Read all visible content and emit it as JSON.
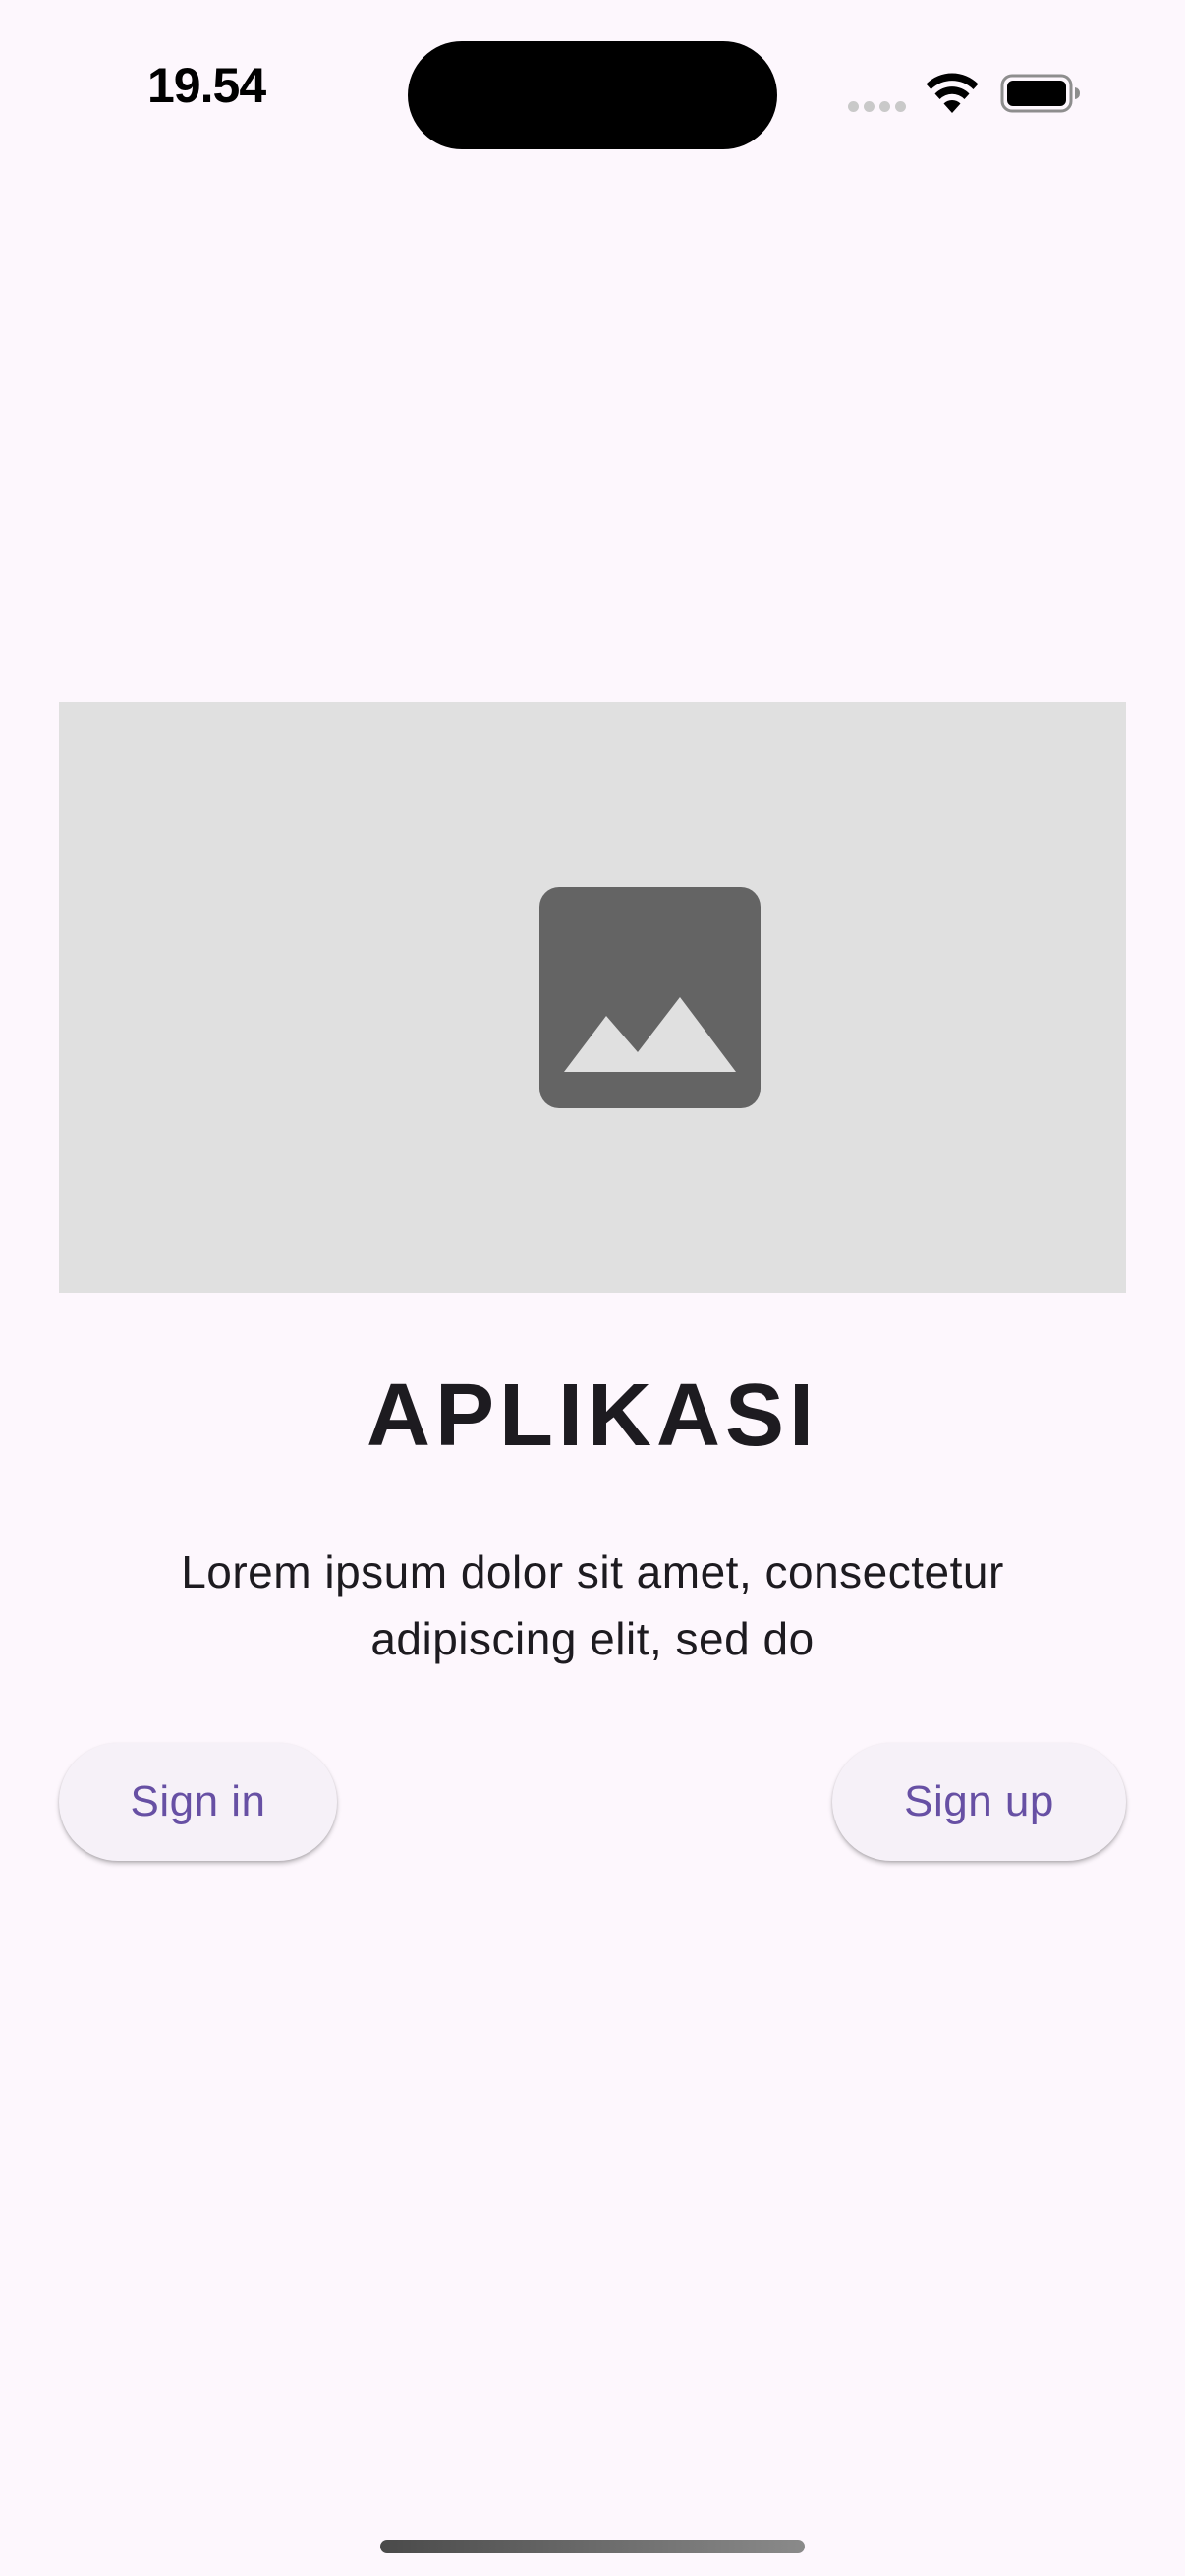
{
  "status_bar": {
    "time": "19.54",
    "icons": [
      "cellular-signal-icon",
      "wifi-icon",
      "battery-icon"
    ]
  },
  "hero": {
    "placeholder_icon": "image-placeholder-icon",
    "background": "#e0e0e0",
    "icon_color": "#646464"
  },
  "content": {
    "title": "APLIKASI",
    "description": "Lorem ipsum dolor sit amet, consectetur adipiscing elit, sed do"
  },
  "actions": {
    "sign_in_label": "Sign in",
    "sign_up_label": "Sign up"
  },
  "colors": {
    "background": "#fdf7fd",
    "button_background": "#f6f1f8",
    "button_text": "#6750a4",
    "text": "#1d1b20"
  }
}
